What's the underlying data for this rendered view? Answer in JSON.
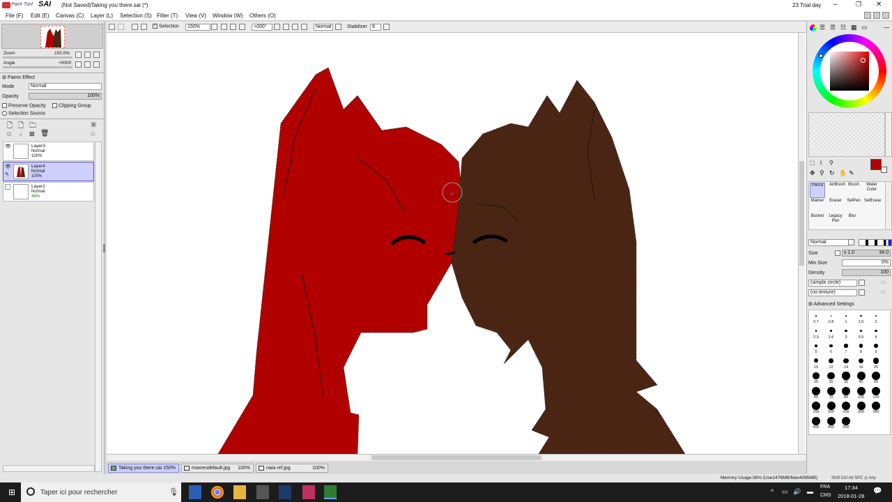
{
  "app": {
    "logo_small": "Paint Tool",
    "logo_big": "SAI",
    "window_title": "(Not Saved)Taking you there.sai (*)",
    "trial": "23 Trial day"
  },
  "menu": [
    "File (F)",
    "Edit (E)",
    "Canvas (C)",
    "Layer (L)",
    "Selection (S)",
    "Filter (T)",
    "View (V)",
    "Window (W)",
    "Others (O)"
  ],
  "toolbar": {
    "selection_label": "Selection",
    "zoom": "150%",
    "angle": "+000°",
    "blend": "Normal",
    "stabilizer_label": "Stabilizer",
    "stabilizer_value": "9"
  },
  "navigator": {
    "zoom_label": "Zoom",
    "zoom_value": "150.0%",
    "angle_label": "Angle",
    "angle_value": "+0000"
  },
  "layer_props": {
    "paints_effect": "Paints Effect",
    "mode_label": "Mode",
    "mode_value": "Normal",
    "opacity_label": "Opacity",
    "opacity_value": "100%",
    "preserve_opacity": "Preserve Opacity",
    "clipping_group": "Clipping Group",
    "selection_source": "Selection Source"
  },
  "layers": [
    {
      "name": "Layer3",
      "mode": "Normal",
      "opacity": "100%"
    },
    {
      "name": "Layer4",
      "mode": "Normal",
      "opacity": "100%"
    },
    {
      "name": "Layer2",
      "mode": "Normal",
      "opacity": "44%"
    }
  ],
  "tools": {
    "row1": [
      "Pencil",
      "AirBrush",
      "Brush",
      "Water Color"
    ],
    "row2": [
      "Marker",
      "Eraser",
      "SelPen",
      "SelErase"
    ],
    "row3": [
      "Bucket",
      "Legacy Pen",
      "Blur"
    ]
  },
  "brush": {
    "blend": "Normal",
    "size_label": "Size",
    "size_mult": "x 1.0",
    "size_value": "34.0",
    "min_size_label": "Min Size",
    "min_size_value": "0%",
    "density_label": "Density",
    "density_value": "100",
    "shape": "(simple circle)",
    "shape_value": "50",
    "texture": "(no texture)",
    "texture_value": "95",
    "advanced": "Advanced Settings"
  },
  "brush_sizes": [
    "0.7",
    "0.8",
    "1",
    "1.5",
    "2",
    "2.3",
    "2.6",
    "3",
    "3.5",
    "4",
    "5",
    "6",
    "7",
    "8",
    "9",
    "10",
    "12",
    "14",
    "16",
    "20",
    "25",
    "30",
    "35",
    "40",
    "50",
    "60",
    "70",
    "80",
    "100",
    "120",
    "160",
    "200",
    "250",
    "300",
    "350",
    "400",
    "450",
    "500"
  ],
  "tabs": [
    {
      "name": "Taking you there.sai",
      "zoom": "150%"
    },
    {
      "name": "maxresdefault.jpg",
      "zoom": "100%"
    },
    {
      "name": "naia ref.jpg",
      "zoom": "100%"
    }
  ],
  "status": {
    "memory": "Memory Usage:36% (Use1476MB/Max4095MB)",
    "keys": "Shift Ctrl Alt SPC ◎ Any"
  },
  "taskbar": {
    "search_placeholder": "Taper ici pour rechercher",
    "lang1": "FRA",
    "lang2": "CMS",
    "time": "17:34",
    "date": "2018-01-28"
  },
  "colors": {
    "red": "#b00000",
    "brown": "#4a2514",
    "accent": "#cfcfff"
  }
}
